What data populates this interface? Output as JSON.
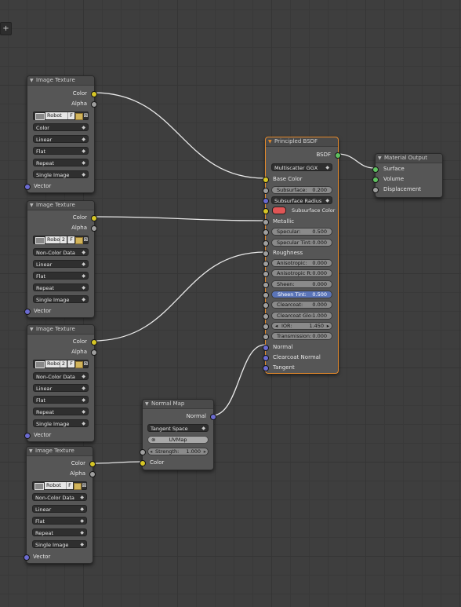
{
  "toolbar": {
    "add_icon": "+"
  },
  "image_textures": [
    {
      "title": "Image Texture",
      "out_color": "Color",
      "out_alpha": "Alpha",
      "image_name": "Robot",
      "image_f": "F",
      "users": "",
      "color_space": "Color",
      "interpolation": "Linear",
      "projection": "Flat",
      "extension": "Repeat",
      "source": "Single Image",
      "vector": "Vector"
    },
    {
      "title": "Image Texture",
      "out_color": "Color",
      "out_alpha": "Alpha",
      "image_name": "Robo",
      "image_f": "F",
      "users": "2",
      "color_space": "Non-Color Data",
      "interpolation": "Linear",
      "projection": "Flat",
      "extension": "Repeat",
      "source": "Single Image",
      "vector": "Vector"
    },
    {
      "title": "Image Texture",
      "out_color": "Color",
      "out_alpha": "Alpha",
      "image_name": "Robo",
      "image_f": "F",
      "users": "2",
      "color_space": "Non-Color Data",
      "interpolation": "Linear",
      "projection": "Flat",
      "extension": "Repeat",
      "source": "Single Image",
      "vector": "Vector"
    },
    {
      "title": "Image Texture",
      "out_color": "Color",
      "out_alpha": "Alpha",
      "image_name": "Robot",
      "image_f": "F",
      "users": "",
      "color_space": "Non-Color Data",
      "interpolation": "Linear",
      "projection": "Flat",
      "extension": "Repeat",
      "source": "Single Image",
      "vector": "Vector"
    }
  ],
  "principled": {
    "title": "Principled BSDF",
    "out_bsdf": "BSDF",
    "distribution": "Multiscatter GGX",
    "base_color": "Base Color",
    "subsurface_label": "Subsurface:",
    "subsurface_value": "0.200",
    "subsurface_radius": "Subsurface Radius",
    "subsurface_color": "Subsurface Color",
    "metallic": "Metallic",
    "specular_label": "Specular:",
    "specular_value": "0.500",
    "specular_tint_label": "Specular Tint:",
    "specular_tint_value": "0.000",
    "roughness": "Roughness",
    "anisotropic_label": "Anisotropic:",
    "anisotropic_value": "0.000",
    "anisotropic_r_label": "Anisotropic R:",
    "anisotropic_r_value": "0.000",
    "sheen_label": "Sheen:",
    "sheen_value": "0.000",
    "sheen_tint_label": "Sheen Tint:",
    "sheen_tint_value": "0.500",
    "clearcoat_label": "Clearcoat:",
    "clearcoat_value": "0.000",
    "clearcoat_glo_label": "Clearcoat Glo:",
    "clearcoat_glo_value": "1.000",
    "ior_label": "IOR:",
    "ior_value": "1.450",
    "transmission_label": "Transmission:",
    "transmission_value": "0.000",
    "normal": "Normal",
    "clearcoat_normal": "Clearcoat Normal",
    "tangent": "Tangent",
    "subsurface_swatch_color": "#e05555"
  },
  "material_output": {
    "title": "Material Output",
    "surface": "Surface",
    "volume": "Volume",
    "displacement": "Displacement"
  },
  "normal_map": {
    "title": "Normal Map",
    "out_normal": "Normal",
    "space": "Tangent Space",
    "uvmap": "UVMap",
    "strength_label": "Strength:",
    "strength_value": "1.000",
    "in_color": "Color"
  },
  "colors": {
    "node_bg": "#565656",
    "active_border": "#e58a2b",
    "socket_color": "#d6c626",
    "socket_vector": "#6b6bd0",
    "socket_shader": "#60c060",
    "socket_float": "#9f9f9f",
    "wire": "#e8e8e8"
  }
}
